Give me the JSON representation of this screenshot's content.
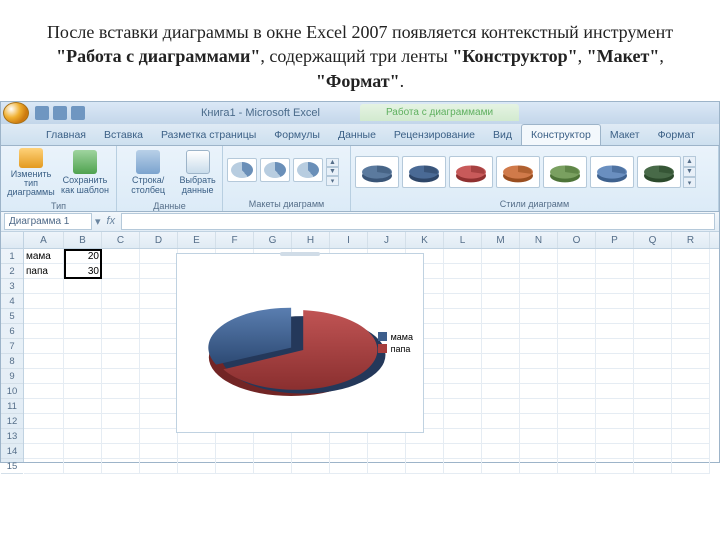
{
  "caption": {
    "p1": "После вставки диаграммы в окне Excel 2007 появляется контекстный инструмент ",
    "b1": "\"Работа с диаграммами\"",
    "p2": ", содержащий три ленты ",
    "b2": "\"Конструктор\"",
    "p3": ", ",
    "b3": "\"Макет\"",
    "p4": ", ",
    "b4": "\"Формат\"",
    "p5": "."
  },
  "titlebar": {
    "doc": "Книга1 - Microsoft Excel",
    "context": "Работа с диаграммами"
  },
  "tabs": {
    "main": [
      "Главная",
      "Вставка",
      "Разметка страницы",
      "Формулы",
      "Данные",
      "Рецензирование",
      "Вид"
    ],
    "ctx": [
      "Конструктор",
      "Макет",
      "Формат"
    ],
    "active": "Конструктор"
  },
  "ribbon": {
    "groups": {
      "type": {
        "title": "Тип",
        "btn_change": "Изменить тип\nдиаграммы",
        "btn_save": "Сохранить\nкак шаблон"
      },
      "data": {
        "title": "Данные",
        "btn_swap": "Строка/столбец",
        "btn_select": "Выбрать\nданные"
      },
      "layouts": {
        "title": "Макеты диаграмм"
      },
      "styles": {
        "title": "Стили диаграмм"
      }
    }
  },
  "namebox": "Диаграмма 1",
  "columns": [
    "A",
    "B",
    "C",
    "D",
    "E",
    "F",
    "G",
    "H",
    "I",
    "J",
    "K",
    "L",
    "M",
    "N",
    "O",
    "P",
    "Q",
    "R"
  ],
  "rows": 15,
  "sheet_data": {
    "r1": {
      "A": "мама",
      "B": "20"
    },
    "r2": {
      "A": "папа",
      "B": "30"
    }
  },
  "chart_data": {
    "type": "pie",
    "title": "",
    "categories": [
      "мама",
      "папа"
    ],
    "values": [
      20,
      30
    ],
    "colors": [
      "#3d5e8c",
      "#a63d3d"
    ],
    "legend_position": "right",
    "style": "3d"
  }
}
